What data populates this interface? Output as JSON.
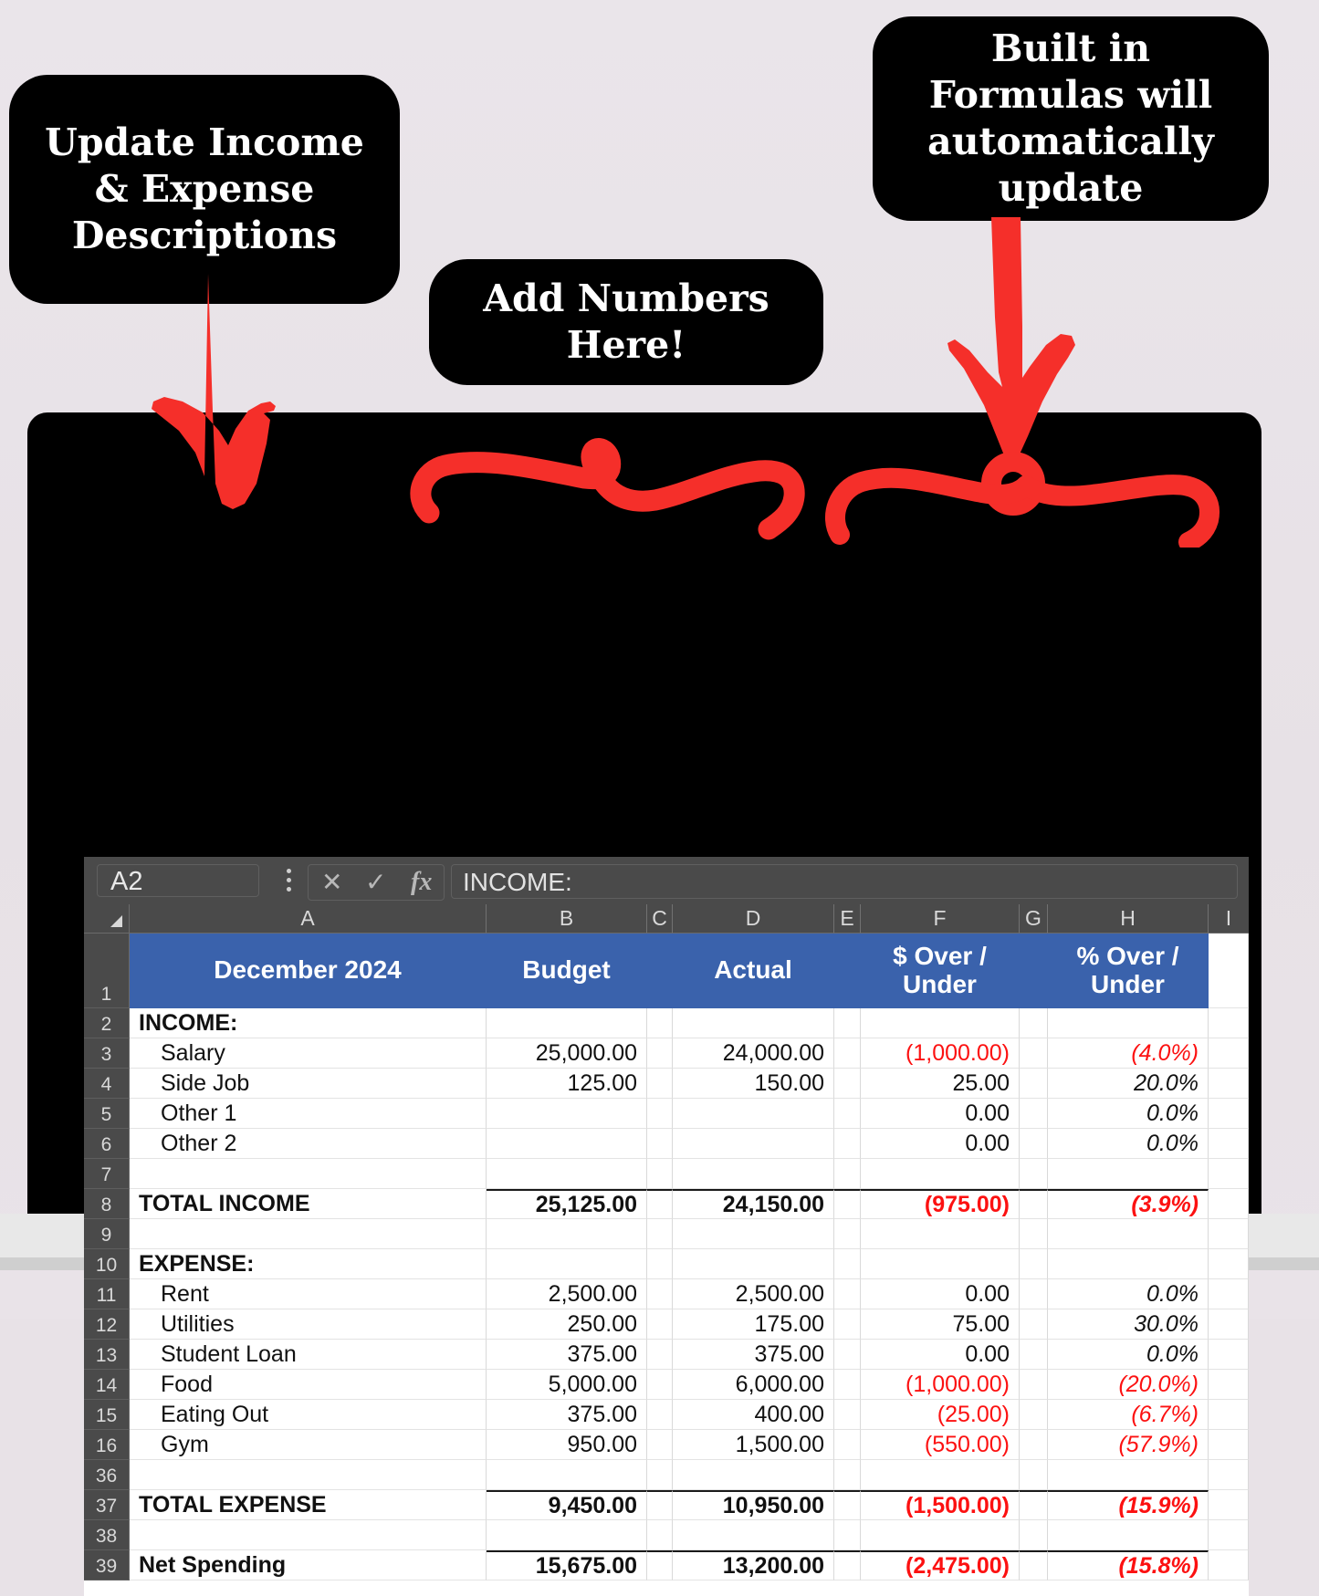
{
  "callouts": {
    "update": "Update Income & Expense Descriptions",
    "add_numbers": "Add Numbers Here!",
    "formulas": "Built in Formulas will automatically update"
  },
  "formula_bar": {
    "name_box": "A2",
    "cancel_icon": "x-icon",
    "confirm_icon": "check-icon",
    "function_icon": "fx-icon",
    "menu_icon": "kebab-menu-icon",
    "value": "INCOME:"
  },
  "spreadsheet": {
    "columns": [
      "A",
      "B",
      "C",
      "D",
      "E",
      "F",
      "G",
      "H",
      "I"
    ],
    "header_row": {
      "number": "1",
      "title": "December 2024",
      "budget": "Budget",
      "actual": "Actual",
      "dollar_over_under": "$ Over / Under",
      "percent_over_under": "%  Over / Under"
    },
    "accent_color": "#3a62ac",
    "negative_color": "#fc1111",
    "rows": [
      {
        "n": "2",
        "label": "INCOME:",
        "bold": true,
        "indent": false,
        "b": "",
        "d": "",
        "f": "",
        "h": "",
        "fneg": false,
        "hneg": false
      },
      {
        "n": "3",
        "label": "Salary",
        "bold": false,
        "indent": true,
        "b": "25,000.00",
        "d": "24,000.00",
        "f": "(1,000.00)",
        "h": "(4.0%)",
        "fneg": true,
        "hneg": true
      },
      {
        "n": "4",
        "label": "Side Job",
        "bold": false,
        "indent": true,
        "b": "125.00",
        "d": "150.00",
        "f": "25.00",
        "h": "20.0%",
        "fneg": false,
        "hneg": false
      },
      {
        "n": "5",
        "label": "Other 1",
        "bold": false,
        "indent": true,
        "b": "",
        "d": "",
        "f": "0.00",
        "h": "0.0%",
        "fneg": false,
        "hneg": false
      },
      {
        "n": "6",
        "label": "Other 2",
        "bold": false,
        "indent": true,
        "b": "",
        "d": "",
        "f": "0.00",
        "h": "0.0%",
        "fneg": false,
        "hneg": false
      },
      {
        "n": "7",
        "label": "",
        "bold": false,
        "indent": false,
        "b": "",
        "d": "",
        "f": "",
        "h": "",
        "fneg": false,
        "hneg": false
      },
      {
        "n": "8",
        "label": "TOTAL INCOME",
        "bold": true,
        "indent": false,
        "b": "25,125.00",
        "d": "24,150.00",
        "f": "(975.00)",
        "h": "(3.9%)",
        "fneg": true,
        "hneg": true,
        "topline": true
      },
      {
        "n": "9",
        "label": "",
        "bold": false,
        "indent": false,
        "b": "",
        "d": "",
        "f": "",
        "h": "",
        "fneg": false,
        "hneg": false
      },
      {
        "n": "10",
        "label": "EXPENSE:",
        "bold": true,
        "indent": false,
        "b": "",
        "d": "",
        "f": "",
        "h": "",
        "fneg": false,
        "hneg": false
      },
      {
        "n": "11",
        "label": "Rent",
        "bold": false,
        "indent": true,
        "b": "2,500.00",
        "d": "2,500.00",
        "f": "0.00",
        "h": "0.0%",
        "fneg": false,
        "hneg": false
      },
      {
        "n": "12",
        "label": "Utilities",
        "bold": false,
        "indent": true,
        "b": "250.00",
        "d": "175.00",
        "f": "75.00",
        "h": "30.0%",
        "fneg": false,
        "hneg": false
      },
      {
        "n": "13",
        "label": "Student Loan",
        "bold": false,
        "indent": true,
        "b": "375.00",
        "d": "375.00",
        "f": "0.00",
        "h": "0.0%",
        "fneg": false,
        "hneg": false
      },
      {
        "n": "14",
        "label": "Food",
        "bold": false,
        "indent": true,
        "b": "5,000.00",
        "d": "6,000.00",
        "f": "(1,000.00)",
        "h": "(20.0%)",
        "fneg": true,
        "hneg": true
      },
      {
        "n": "15",
        "label": "Eating Out",
        "bold": false,
        "indent": true,
        "b": "375.00",
        "d": "400.00",
        "f": "(25.00)",
        "h": "(6.7%)",
        "fneg": true,
        "hneg": true
      },
      {
        "n": "16",
        "label": "Gym",
        "bold": false,
        "indent": true,
        "b": "950.00",
        "d": "1,500.00",
        "f": "(550.00)",
        "h": "(57.9%)",
        "fneg": true,
        "hneg": true
      },
      {
        "n": "36",
        "label": "",
        "bold": false,
        "indent": false,
        "b": "",
        "d": "",
        "f": "",
        "h": "",
        "fneg": false,
        "hneg": false
      },
      {
        "n": "37",
        "label": "TOTAL EXPENSE",
        "bold": true,
        "indent": false,
        "b": "9,450.00",
        "d": "10,950.00",
        "f": "(1,500.00)",
        "h": "(15.9%)",
        "fneg": true,
        "hneg": true,
        "topline": true
      },
      {
        "n": "38",
        "label": "",
        "bold": false,
        "indent": false,
        "b": "",
        "d": "",
        "f": "",
        "h": "",
        "fneg": false,
        "hneg": false
      },
      {
        "n": "39",
        "label": "Net Spending",
        "bold": true,
        "indent": false,
        "b": "15,675.00",
        "d": "13,200.00",
        "f": "(2,475.00)",
        "h": "(15.8%)",
        "fneg": true,
        "hneg": true,
        "topline": true
      }
    ]
  }
}
